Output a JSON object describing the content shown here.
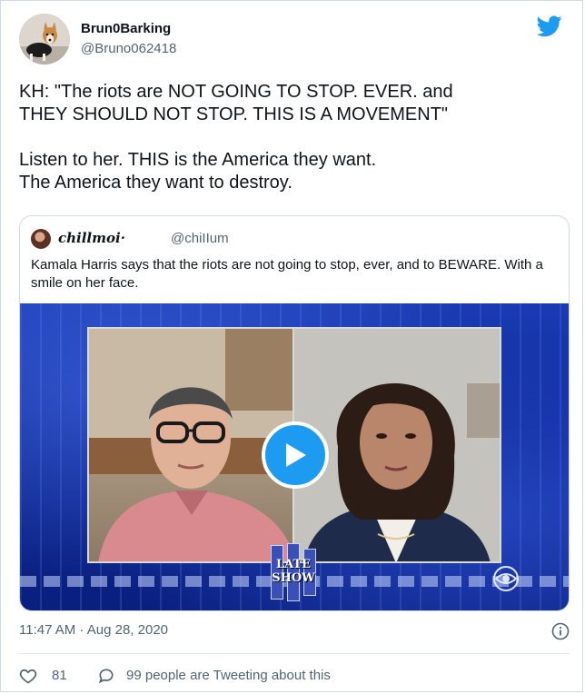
{
  "author": {
    "name": "Brun0Barking",
    "handle": "@Bruno062418",
    "avatar_icon": "dog-avatar-icon"
  },
  "brand": {
    "icon": "twitter-bird-icon",
    "color": "#1d9bf0"
  },
  "tweet": {
    "lines": [
      "KH:  \"The riots are NOT GOING TO STOP. EVER. and",
      "THEY SHOULD NOT STOP.  THIS IS A MOVEMENT\"",
      "",
      "Listen to her.  THIS is the America they want.",
      "The America they want to destroy."
    ]
  },
  "quoted": {
    "name": "chillmoi·",
    "handle": "@chiIIum",
    "text": "Kamala Harris says that the riots are not going to stop, ever, and to BEWARE. With a smile on her face.",
    "video": {
      "logo_line1": "LATE",
      "logo_line2": "SHOW",
      "play_icon": "play-icon",
      "network_icon": "cbs-eye-icon"
    }
  },
  "meta": {
    "timestamp": "11:47 AM · Aug 28, 2020",
    "info_icon": "info-icon"
  },
  "actions": {
    "like_count": "81",
    "reply_text": "99 people are Tweeting about this"
  }
}
